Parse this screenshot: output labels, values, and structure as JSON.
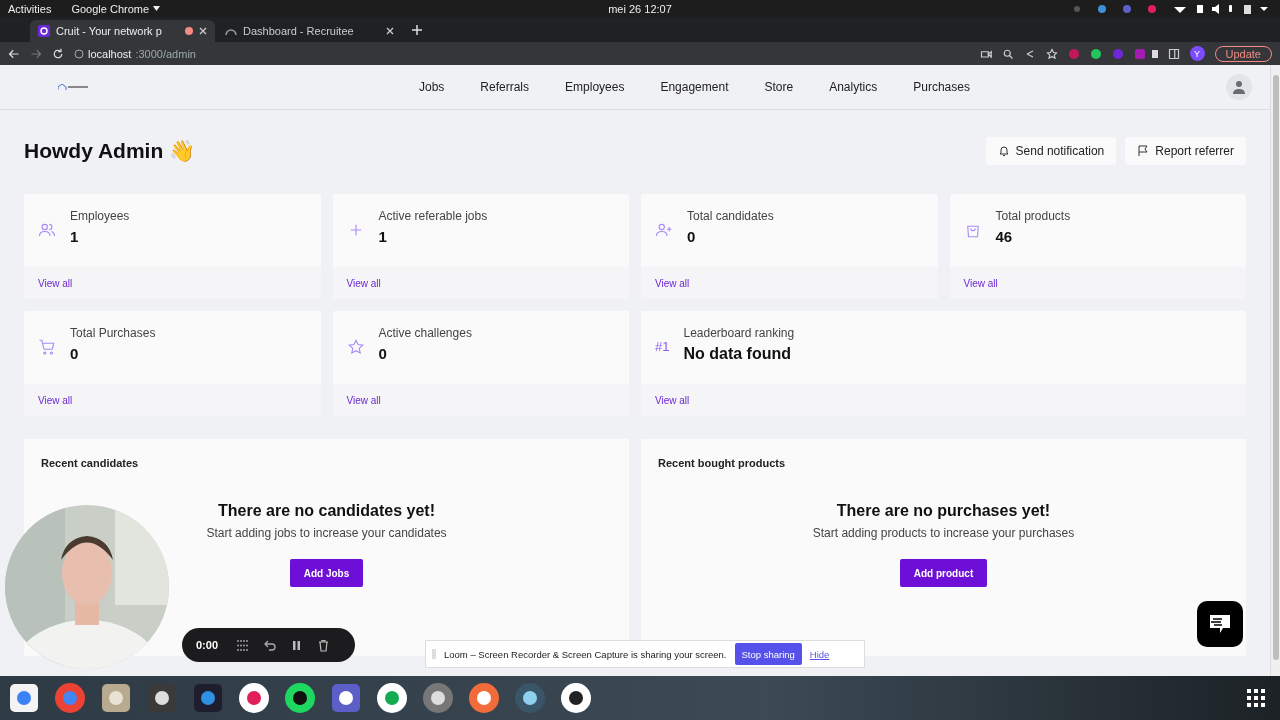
{
  "system_bar": {
    "activities": "Activities",
    "app": "Google Chrome",
    "clock": "mei 26  12:07"
  },
  "browser": {
    "tabs": [
      {
        "title": "Cruit - Your network p",
        "selected": true,
        "kind": "app"
      },
      {
        "title": "Dashboard - Recruitee",
        "selected": false,
        "kind": "cloud"
      }
    ],
    "url_host": "localhost",
    "url_path": ":3000/admin",
    "profile": "Y",
    "update": "Update"
  },
  "nav": {
    "items": [
      "Jobs",
      "Referrals",
      "Employees",
      "Engagement",
      "Store",
      "Analytics",
      "Purchases"
    ]
  },
  "greeting": {
    "text": "Howdy Admin",
    "emoji": "👋"
  },
  "actions": [
    {
      "label": "Send notification",
      "kind": "bell"
    },
    {
      "label": "Report referrer",
      "kind": "flag"
    }
  ],
  "stats": [
    {
      "label": "Employees",
      "value": "1",
      "kind": "users",
      "link": "View all",
      "wide": false
    },
    {
      "label": "Active referable jobs",
      "value": "1",
      "kind": "plus",
      "link": "View all",
      "wide": false
    },
    {
      "label": "Total candidates",
      "value": "0",
      "kind": "user-plus",
      "link": "View all",
      "wide": false
    },
    {
      "label": "Total products",
      "value": "46",
      "kind": "bag",
      "link": "View all",
      "wide": false
    },
    {
      "label": "Total Purchases",
      "value": "0",
      "kind": "cart",
      "link": "View all",
      "wide": false
    },
    {
      "label": "Active challenges",
      "value": "0",
      "kind": "star",
      "link": "View all",
      "wide": false
    },
    {
      "label": "Leaderboard ranking",
      "value": "No data found",
      "kind": "rank",
      "badge": "#1",
      "link": "View all",
      "wide": true
    }
  ],
  "panels": [
    {
      "title": "Recent candidates",
      "empty_title": "There are no candidates yet!",
      "empty_text": "Start adding jobs to increase your candidates",
      "button": "Add Jobs"
    },
    {
      "title": "Recent bought products",
      "empty_title": "There are no purchases yet!",
      "empty_text": "Start adding products to increase your purchases",
      "button": "Add product"
    }
  ],
  "recorder": {
    "time": "0:00"
  },
  "loom_banner": {
    "text": "Loom – Screen Recorder & Screen Capture is sharing your screen.",
    "stop": "Stop sharing",
    "hide": "Hide"
  },
  "dock": {
    "apps": [
      {
        "kind": "editor"
      },
      {
        "kind": "chrome"
      },
      {
        "kind": "files"
      },
      {
        "kind": "terminal"
      },
      {
        "kind": "code"
      },
      {
        "kind": "slack"
      },
      {
        "kind": "spotify"
      },
      {
        "kind": "teams"
      },
      {
        "kind": "leaf"
      },
      {
        "kind": "gear"
      },
      {
        "kind": "pen"
      },
      {
        "kind": "swirl"
      },
      {
        "kind": "keyboard"
      }
    ]
  }
}
